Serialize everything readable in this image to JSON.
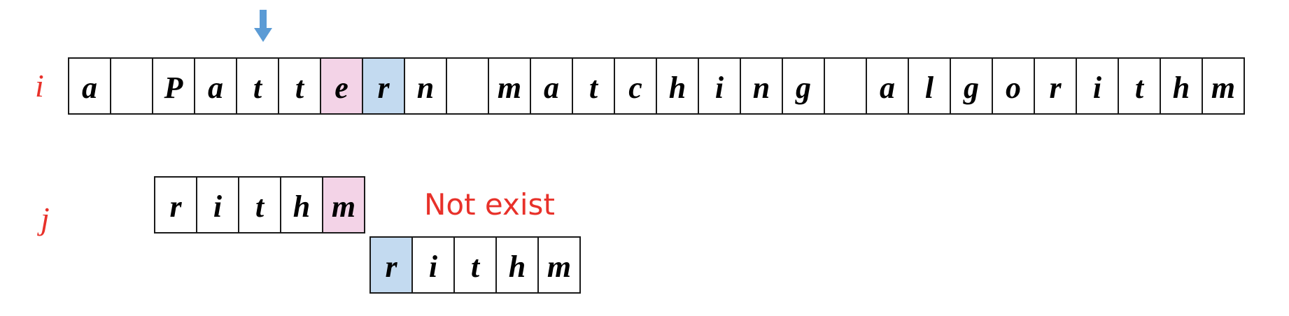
{
  "labels": {
    "i": "i",
    "j": "j"
  },
  "note": "Not exist",
  "colors": {
    "mismatch": "#f3d3e7",
    "aligned": "#c3daf0",
    "label": "#e8312a",
    "arrow": "#5b9bd5"
  },
  "text_cells": [
    {
      "char": "a",
      "highlight": ""
    },
    {
      "char": "",
      "highlight": ""
    },
    {
      "char": "P",
      "highlight": ""
    },
    {
      "char": "a",
      "highlight": ""
    },
    {
      "char": "t",
      "highlight": ""
    },
    {
      "char": "t",
      "highlight": ""
    },
    {
      "char": "e",
      "highlight": "pink"
    },
    {
      "char": "r",
      "highlight": "blue"
    },
    {
      "char": "n",
      "highlight": ""
    },
    {
      "char": "",
      "highlight": ""
    },
    {
      "char": "m",
      "highlight": ""
    },
    {
      "char": "a",
      "highlight": ""
    },
    {
      "char": "t",
      "highlight": ""
    },
    {
      "char": "c",
      "highlight": ""
    },
    {
      "char": "h",
      "highlight": ""
    },
    {
      "char": "i",
      "highlight": ""
    },
    {
      "char": "n",
      "highlight": ""
    },
    {
      "char": "g",
      "highlight": ""
    },
    {
      "char": "",
      "highlight": ""
    },
    {
      "char": "a",
      "highlight": ""
    },
    {
      "char": "l",
      "highlight": ""
    },
    {
      "char": "g",
      "highlight": ""
    },
    {
      "char": "o",
      "highlight": ""
    },
    {
      "char": "r",
      "highlight": ""
    },
    {
      "char": "i",
      "highlight": ""
    },
    {
      "char": "t",
      "highlight": ""
    },
    {
      "char": "h",
      "highlight": ""
    },
    {
      "char": "m",
      "highlight": ""
    }
  ],
  "pattern_before": [
    {
      "char": "r",
      "highlight": ""
    },
    {
      "char": "i",
      "highlight": ""
    },
    {
      "char": "t",
      "highlight": ""
    },
    {
      "char": "h",
      "highlight": ""
    },
    {
      "char": "m",
      "highlight": "pink"
    }
  ],
  "pattern_after": [
    {
      "char": "r",
      "highlight": "blue"
    },
    {
      "char": "i",
      "highlight": ""
    },
    {
      "char": "t",
      "highlight": ""
    },
    {
      "char": "h",
      "highlight": ""
    },
    {
      "char": "m",
      "highlight": ""
    }
  ],
  "pointer_icon": "down-arrow-icon"
}
